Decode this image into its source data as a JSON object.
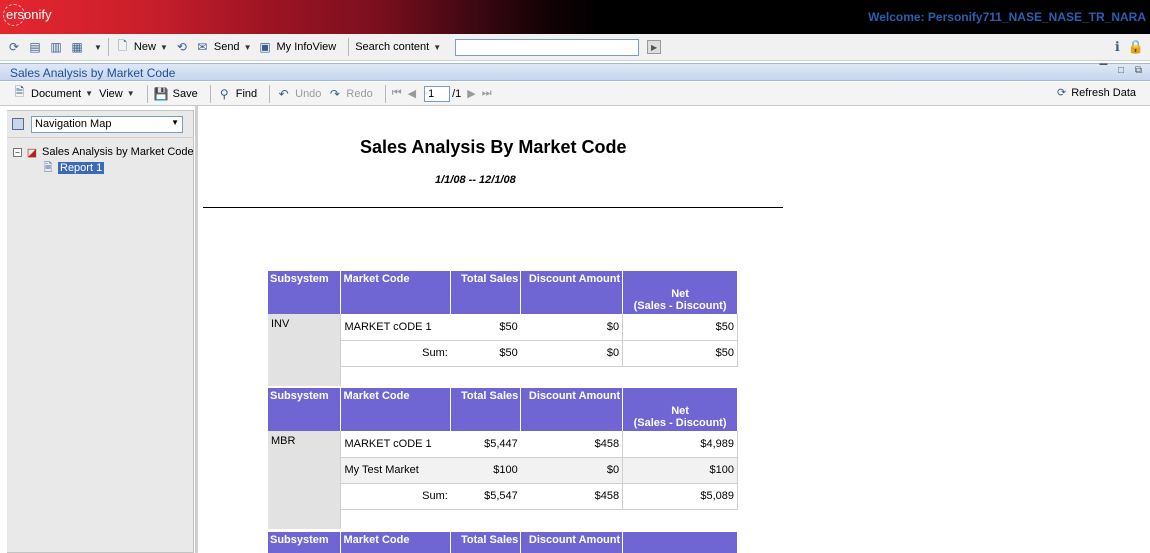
{
  "banner": {
    "logo": "ersonify",
    "welcome": "Welcome: Personify711_NASE_NASE_TR_NARA"
  },
  "toolbar": {
    "new_label": "New",
    "send_label": "Send",
    "myinfoview_label": "My InfoView",
    "search_label": "Search content",
    "search_value": ""
  },
  "titlebar": {
    "title": "Sales Analysis by Market Code"
  },
  "doc_toolbar": {
    "document_label": "Document",
    "view_label": "View",
    "save_label": "Save",
    "find_label": "Find",
    "undo_label": "Undo",
    "redo_label": "Redo",
    "page_current": "1",
    "page_total": "/1",
    "refresh_label": "Refresh Data"
  },
  "nav": {
    "select_value": "Navigation Map",
    "tree_root": "Sales Analysis by Market Code",
    "tree_child": "Report 1"
  },
  "report": {
    "title": "Sales Analysis By Market Code",
    "date_range": "1/1/08  --  12/1/08",
    "headers": {
      "subsystem": "Subsystem",
      "market_code": "Market Code",
      "total_sales": "Total Sales",
      "discount": "Discount Amount",
      "net_line1": "Net",
      "net_line2": "(Sales - Discount)"
    },
    "sum_label": "Sum:",
    "groups": [
      {
        "subsystem": "INV",
        "rows": [
          {
            "market_code": "MARKET cODE 1",
            "total_sales": "$50",
            "discount": "$0",
            "net": "$50"
          }
        ],
        "sum": {
          "total_sales": "$50",
          "discount": "$0",
          "net": "$50"
        }
      },
      {
        "subsystem": "MBR",
        "rows": [
          {
            "market_code": "MARKET cODE 1",
            "total_sales": "$5,447",
            "discount": "$458",
            "net": "$4,989"
          },
          {
            "market_code": "My Test Market",
            "total_sales": "$100",
            "discount": "$0",
            "net": "$100"
          }
        ],
        "sum": {
          "total_sales": "$5,547",
          "discount": "$458",
          "net": "$5,089"
        }
      }
    ]
  }
}
